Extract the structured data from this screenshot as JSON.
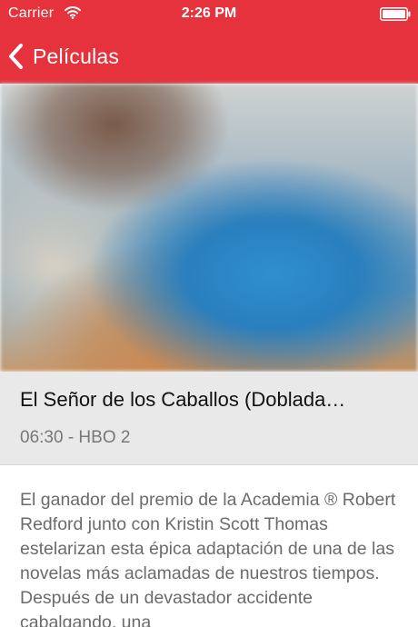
{
  "status_bar": {
    "carrier": "Carrier",
    "time": "2:26 PM",
    "wifi_icon": "wifi-icon",
    "battery_icon": "battery-full-icon"
  },
  "nav": {
    "back_label": "Películas",
    "back_icon": "chevron-left-icon"
  },
  "colors": {
    "accent": "#e5323c",
    "title_bg": "#e9e9e9",
    "body_text": "#6b6b6b"
  },
  "program": {
    "title": "El Señor de los Caballos (Doblada…",
    "schedule": "06:30 - HBO 2",
    "description": "El ganador del premio de la Academia ® Robert Redford junto con Kristin Scott Thomas estelarizan esta épica adaptación de una de las novelas más aclamadas de nuestros tiempos. Después de un devastador accidente cabalgando, una"
  }
}
